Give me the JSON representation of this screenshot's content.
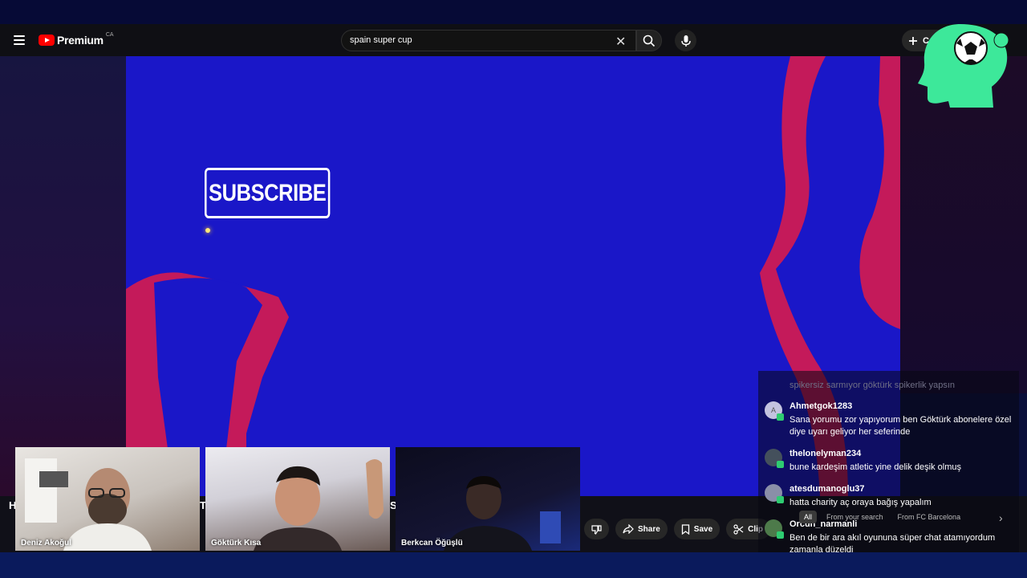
{
  "header": {
    "brand": "Premium",
    "region": "CA",
    "search_value": "spain super cup",
    "create_label": "C"
  },
  "video": {
    "subscribe_label": "SUBSCRIBE",
    "title_fragments": [
      "H",
      "T",
      "S"
    ]
  },
  "actions": [
    {
      "label": "Share",
      "icon": "share-icon"
    },
    {
      "label": "Save",
      "icon": "bookmark-icon"
    },
    {
      "label": "Clip",
      "icon": "scissors-icon"
    }
  ],
  "participants": [
    {
      "name": "Deniz Akoğul"
    },
    {
      "name": "Göktürk Kısa"
    },
    {
      "name": "Berkcan Öğüşlü"
    }
  ],
  "chat": {
    "faded_message": "spikersiz sarmıyor göktürk spikerlik yapsın",
    "messages": [
      {
        "author": "Ahmetgok1283",
        "avatar_letter": "A",
        "text": "Sana yorumu zor yapıyorum ben Göktürk abonelere özel diye uyarı geliyor her seferinde"
      },
      {
        "author": "thelonelyman234",
        "avatar_letter": "",
        "text": "bune kardeşim atletic yine delik deşik olmuş"
      },
      {
        "author": "atesdumanoglu37",
        "avatar_letter": "",
        "text": "hatta charity aç oraya bağış yapalım"
      },
      {
        "author": "Orcun_narmanli",
        "avatar_letter": "",
        "text": "Ben de bir ara akıl oyununa süper chat atamıyordum zamanla düzeldi"
      }
    ],
    "filters": [
      "All",
      "From your search",
      "From FC Barcelona"
    ]
  },
  "colors": {
    "video_blue": "#1a17c8",
    "club_red": "#c41a5a",
    "badge_green": "#3de89a"
  }
}
